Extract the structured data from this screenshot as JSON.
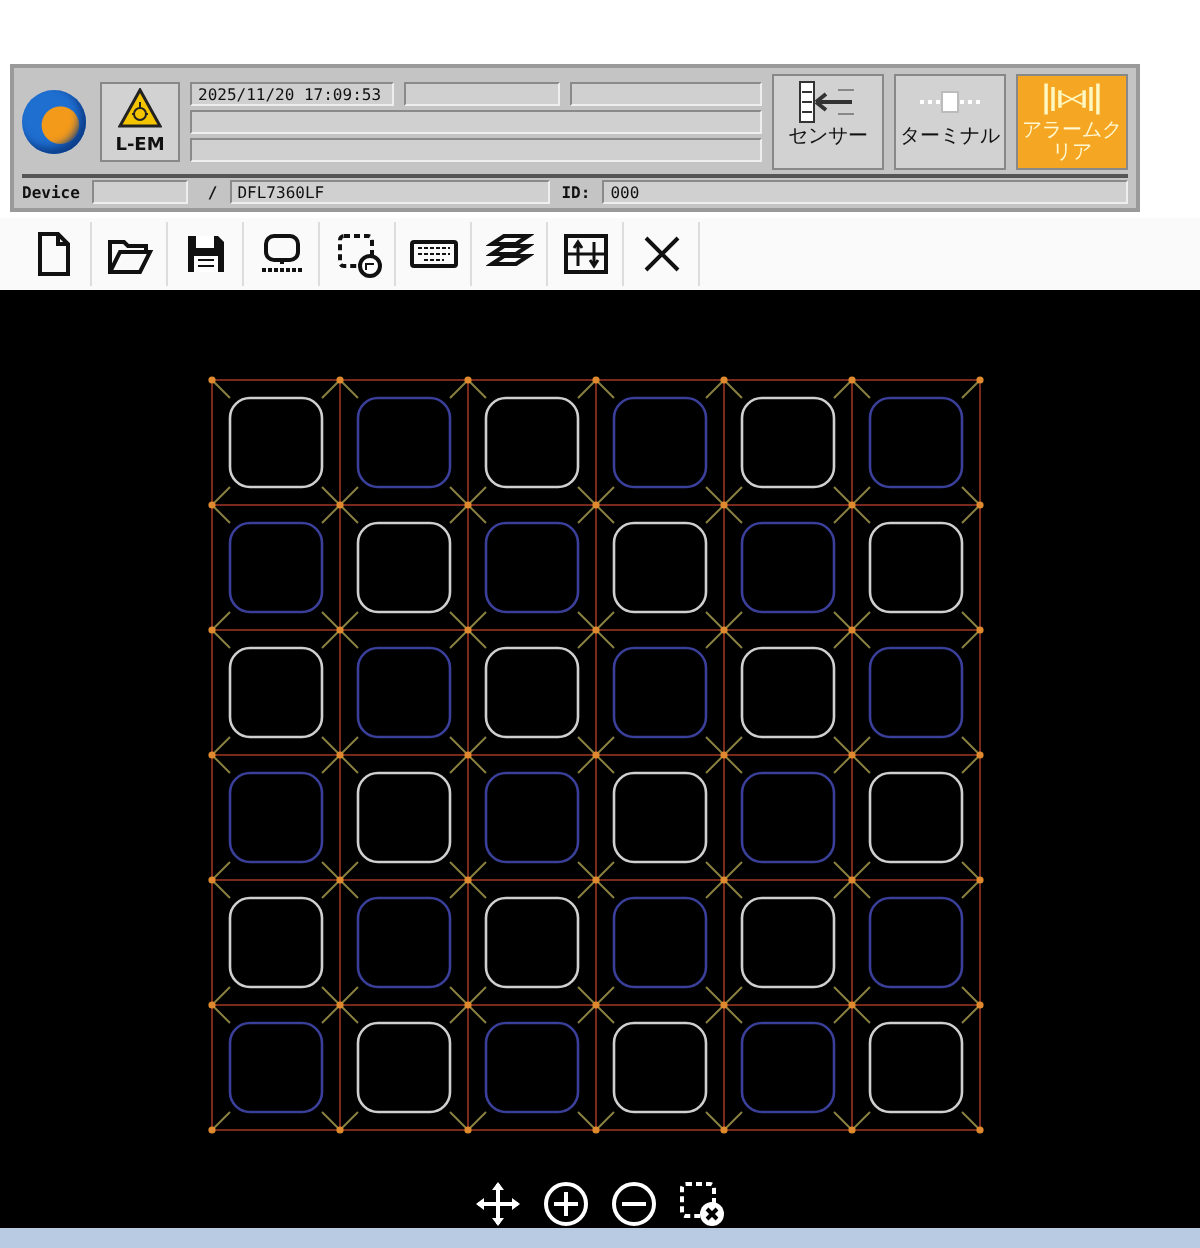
{
  "status_panel": {
    "lem_button": {
      "label": "L-EM"
    },
    "datetime": "2025/11/20 17:09:53",
    "device_label": "Device",
    "separator": "/",
    "device_name": "DFL7360LF",
    "id_label": "ID:",
    "id_value": "000"
  },
  "side_buttons": [
    {
      "kind": "sensor",
      "label": "センサー",
      "active": false
    },
    {
      "kind": "terminal",
      "label": "ターミナル",
      "active": false
    },
    {
      "kind": "alarm",
      "label": "アラームクリア",
      "active": true
    }
  ],
  "toolbar": [
    {
      "kind": "new"
    },
    {
      "kind": "open"
    },
    {
      "kind": "save"
    },
    {
      "kind": "shape"
    },
    {
      "kind": "select"
    },
    {
      "kind": "keyboard"
    },
    {
      "kind": "layers"
    },
    {
      "kind": "align"
    },
    {
      "kind": "close"
    }
  ],
  "view_tools": [
    {
      "kind": "move"
    },
    {
      "kind": "zoom_in"
    },
    {
      "kind": "zoom_out"
    },
    {
      "kind": "clear"
    }
  ]
}
